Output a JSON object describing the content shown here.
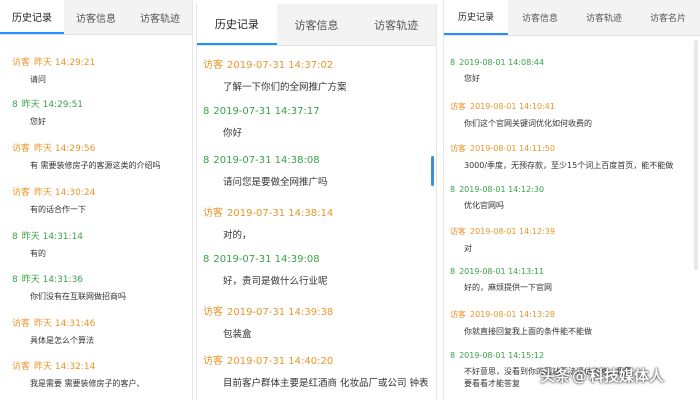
{
  "panel1": {
    "tabs": [
      "历史记录",
      "访客信息",
      "访客轨迹"
    ],
    "messages": [
      {
        "who": "访客",
        "time": "昨天 14:29:21",
        "text": "请问",
        "role": "guest"
      },
      {
        "who": "8",
        "time": "昨天 14:29:51",
        "text": "您好",
        "role": "agent"
      },
      {
        "who": "访客",
        "time": "昨天 14:29:56",
        "text": "有  需要装修房子的客源这类的介绍吗",
        "role": "guest"
      },
      {
        "who": "访客",
        "time": "昨天 14:30:24",
        "text": "有的话合作一下",
        "role": "guest"
      },
      {
        "who": "8",
        "time": "昨天 14:31:14",
        "text": "有的",
        "role": "agent"
      },
      {
        "who": "8",
        "time": "昨天 14:31:36",
        "text": "你们没有在互联网做招商吗",
        "role": "agent"
      },
      {
        "who": "访客",
        "time": "昨天 14:31:46",
        "text": "具体是怎么个算法",
        "role": "guest"
      },
      {
        "who": "访客",
        "time": "昨天 14:32:14",
        "text": "我是需要  需要装修房子的客户、",
        "role": "guest"
      }
    ]
  },
  "panel2": {
    "tabs": [
      "历史记录",
      "访客信息",
      "访客轨迹"
    ],
    "messages": [
      {
        "who": "访客",
        "time": "2019-07-31 14:37:02",
        "text": "了解一下你们的全网推广方案",
        "role": "guest"
      },
      {
        "who": "8",
        "time": "2019-07-31 14:37:17",
        "text": "你好",
        "role": "agent"
      },
      {
        "who": "8",
        "time": "2019-07-31 14:38:08",
        "text": "请问您是要做全网推广吗",
        "role": "agent"
      },
      {
        "who": "访客",
        "time": "2019-07-31 14:38:14",
        "text": "对的，",
        "role": "guest"
      },
      {
        "who": "8",
        "time": "2019-07-31 14:39:08",
        "text": "好，贵司是做什么行业呢",
        "role": "agent"
      },
      {
        "who": "访客",
        "time": "2019-07-31 14:39:38",
        "text": "包装盒",
        "role": "guest"
      },
      {
        "who": "访客",
        "time": "2019-07-31 14:40:20",
        "text": "目前客户群体主要是红酒商 化妆品厂或公司 钟表",
        "role": "guest"
      }
    ]
  },
  "panel3": {
    "tabs": [
      "历史记录",
      "访客信息",
      "访客轨迹",
      "访客名片"
    ],
    "messages": [
      {
        "who": "8",
        "time": "2019-08-01 14:08:44",
        "text": "您好",
        "role": "agent"
      },
      {
        "who": "访客",
        "time": "2019-08-01 14:10:41",
        "text": "你们这个官网关键词优化如何收费的",
        "role": "guest"
      },
      {
        "who": "访客",
        "time": "2019-08-01 14:11:50",
        "text": "3000/季度，无预存款，至少15个词上百度首页，能不能做",
        "role": "guest"
      },
      {
        "who": "8",
        "time": "2019-08-01 14:12:30",
        "text": "优化官网吗",
        "role": "agent"
      },
      {
        "who": "访客",
        "time": "2019-08-01 14:12:39",
        "text": "对",
        "role": "guest"
      },
      {
        "who": "8",
        "time": "2019-08-01 14:13:11",
        "text": "好的，麻烦提供一下官网",
        "role": "agent"
      },
      {
        "who": "访客",
        "time": "2019-08-01 14:13:28",
        "text": "你就直接回复我上面的条件能不能做",
        "role": "guest"
      },
      {
        "who": "8",
        "time": "2019-08-01 14:15:12",
        "text": "不好意思，没看到你的网站无法评估价格，我需要看看才能答复",
        "role": "agent"
      }
    ]
  },
  "watermark": {
    "prefix": "头条",
    "at": "@",
    "name": "科技媒体人"
  }
}
